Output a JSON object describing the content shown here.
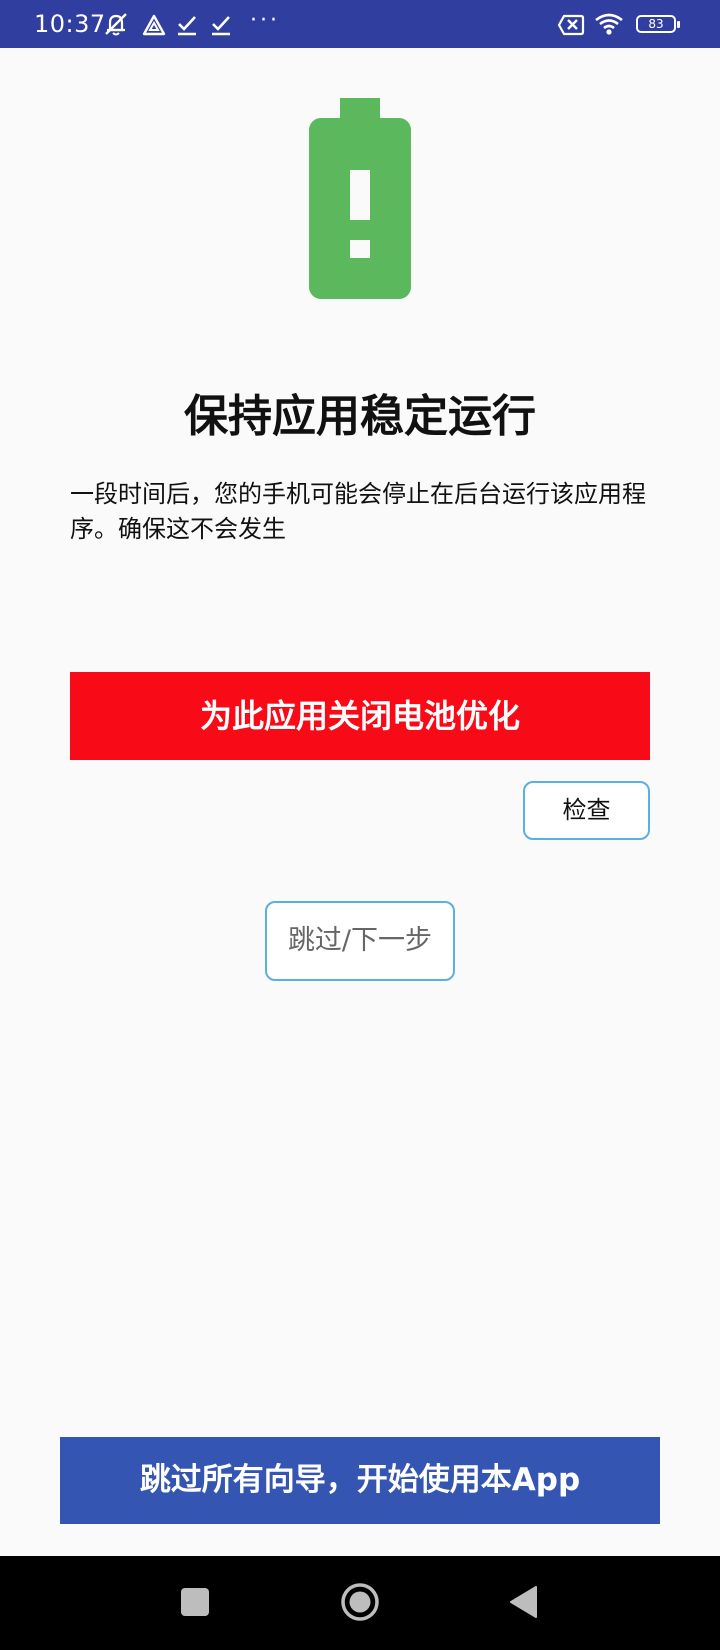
{
  "status_bar": {
    "time": "10:37",
    "icons": [
      "mute-icon",
      "location-icon",
      "check-icon",
      "check-icon",
      "more-dots-icon",
      "sim-off-icon",
      "wifi-icon",
      "battery-icon"
    ],
    "more": "···",
    "battery_level": "83"
  },
  "main": {
    "illustration": "battery-alert-icon",
    "illustration_color": "#5cb85c",
    "title": "保持应用稳定运行",
    "description": "一段时间后，您的手机可能会停止在后台运行该应用程序。确保这不会发生",
    "primary_button": "为此应用关闭电池优化",
    "primary_color": "#f80a17",
    "check_button": "检查",
    "skip_button": "跳过/下一步",
    "skip_all_button": "跳过所有向导，开始使用本App",
    "skip_all_color": "#3456b2"
  },
  "nav_bar": {
    "items": [
      "recents-icon",
      "home-icon",
      "back-icon"
    ]
  }
}
